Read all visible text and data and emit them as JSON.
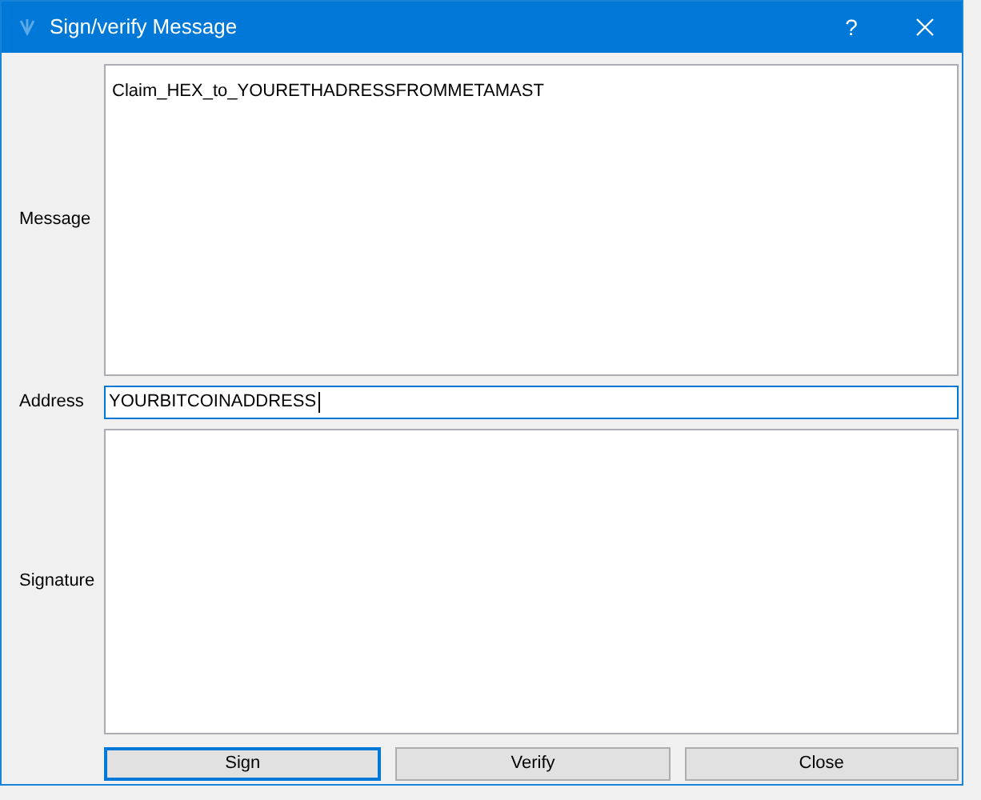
{
  "window": {
    "title": "Sign/verify Message",
    "help": "?"
  },
  "fields": [
    {
      "kind": "multiline",
      "label": "Message",
      "value": "Claim_HEX_to_YOURETHADRESSFROMMETAMAST",
      "focused": false
    },
    {
      "kind": "line",
      "label": "Address",
      "value": "YOURBITCOINADDRESS",
      "focused": true
    },
    {
      "kind": "multiline",
      "label": "Signature",
      "focused": false
    }
  ],
  "buttons": [
    {
      "label": "Sign",
      "focused": true
    },
    {
      "label": "Verify",
      "focused": false
    },
    {
      "label": "Close",
      "focused": false
    }
  ]
}
